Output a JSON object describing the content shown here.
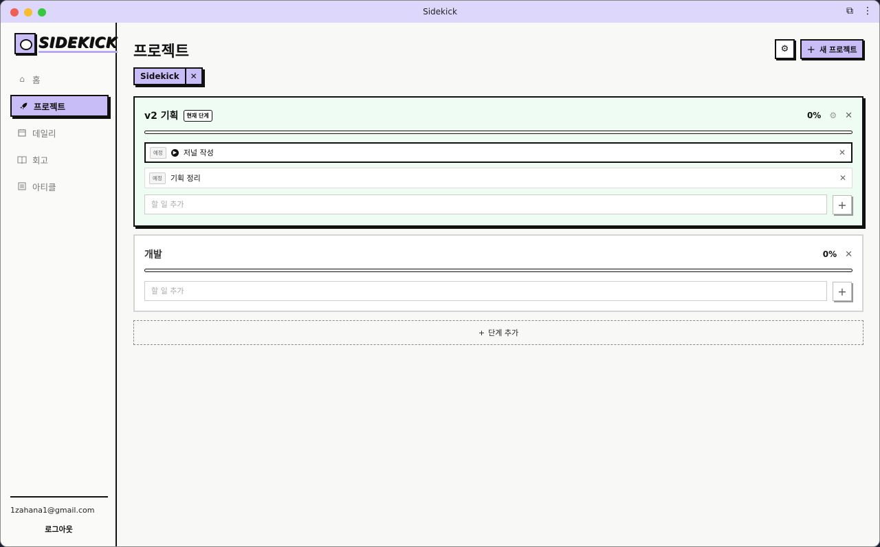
{
  "window": {
    "title": "Sidekick"
  },
  "sidebar": {
    "logo_text": "SIDEKICK",
    "items": [
      {
        "label": "홈",
        "icon": "home-icon",
        "glyph": "⌂",
        "active": false
      },
      {
        "label": "프로젝트",
        "icon": "rocket-icon",
        "glyph": "🚀",
        "active": true
      },
      {
        "label": "데일리",
        "icon": "calendar-icon",
        "glyph": "▣",
        "active": false
      },
      {
        "label": "회고",
        "icon": "book-icon",
        "glyph": "▭",
        "active": false
      },
      {
        "label": "아티클",
        "icon": "article-icon",
        "glyph": "☰",
        "active": false
      }
    ],
    "email": "1zahana1@gmail.com",
    "logout": "로그아웃"
  },
  "main": {
    "title": "프로젝트",
    "new_project_label": "새 프로젝트",
    "project_chip": "Sidekick",
    "stages": [
      {
        "name": "v2 기획",
        "badge": "현재 단계",
        "percent": "0%",
        "progress": 0,
        "tasks": [
          {
            "tag": "예정",
            "text": "저널 작성",
            "selected": true
          },
          {
            "tag": "예정",
            "text": "기획 정리",
            "selected": false
          }
        ],
        "add_placeholder": "할 일 추가"
      },
      {
        "name": "개발",
        "percent": "0%",
        "progress": 0,
        "tasks": [],
        "add_placeholder": "할 일 추가"
      }
    ],
    "add_stage_label": "단계 추가"
  },
  "colors": {
    "accent": "#c8bdf6",
    "current_stage_bg": "#eefcf4",
    "titlebar": "#ddd7fb"
  }
}
